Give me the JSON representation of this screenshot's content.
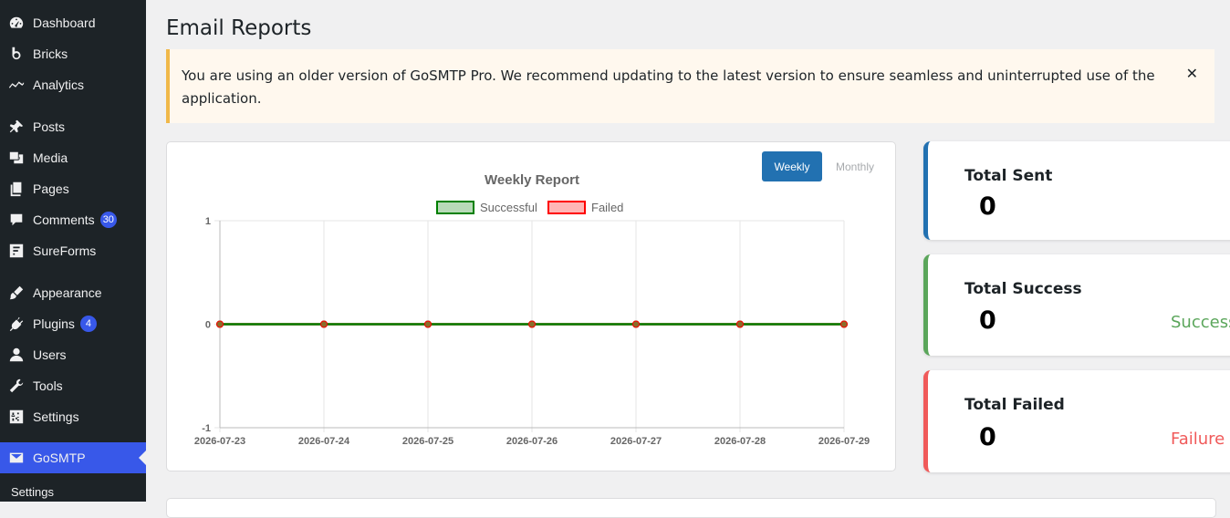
{
  "sidebar": {
    "items": [
      {
        "label": "Dashboard",
        "icon": "dashboard-icon"
      },
      {
        "label": "Bricks",
        "icon": "bricks-icon"
      },
      {
        "label": "Analytics",
        "icon": "analytics-icon"
      },
      {
        "label": "Posts",
        "icon": "pin-icon"
      },
      {
        "label": "Media",
        "icon": "media-icon"
      },
      {
        "label": "Pages",
        "icon": "pages-icon"
      },
      {
        "label": "Comments",
        "icon": "comment-icon",
        "badge": "30"
      },
      {
        "label": "SureForms",
        "icon": "sureforms-icon"
      },
      {
        "label": "Appearance",
        "icon": "brush-icon"
      },
      {
        "label": "Plugins",
        "icon": "plugin-icon",
        "badge": "4"
      },
      {
        "label": "Users",
        "icon": "user-icon"
      },
      {
        "label": "Tools",
        "icon": "wrench-icon"
      },
      {
        "label": "Settings",
        "icon": "settings-icon"
      },
      {
        "label": "GoSMTP",
        "icon": "envelope-icon",
        "active": true
      }
    ],
    "submenu": {
      "label": "Settings"
    }
  },
  "page": {
    "title": "Email Reports"
  },
  "notice": {
    "text": "You are using an older version of GoSMTP Pro. We recommend updating to the latest version to ensure seamless and uninterrupted use of the application.",
    "close": "✕"
  },
  "chart_controls": {
    "weekly": "Weekly",
    "monthly": "Monthly",
    "selected": "Weekly"
  },
  "chart_data": {
    "type": "line",
    "title": "Weekly Report",
    "categories": [
      "2026-07-23",
      "2026-07-24",
      "2026-07-25",
      "2026-07-26",
      "2026-07-27",
      "2026-07-28",
      "2026-07-29"
    ],
    "series": [
      {
        "name": "Successful",
        "values": [
          0,
          0,
          0,
          0,
          0,
          0,
          0
        ],
        "color": "#008000",
        "fill": "#b8dab8"
      },
      {
        "name": "Failed",
        "values": [
          0,
          0,
          0,
          0,
          0,
          0,
          0
        ],
        "color": "#ff0000",
        "fill": "#ffb6b6"
      }
    ],
    "ylim": [
      -1,
      1
    ],
    "yticks": [
      1,
      0,
      -1
    ],
    "grid": true,
    "legend": "top"
  },
  "stats": {
    "sent": {
      "title": "Total Sent",
      "value": "0",
      "color": "#2271b1"
    },
    "success": {
      "title": "Total Success",
      "value": "0",
      "status": "Success",
      "color": "#5ba65b"
    },
    "failed": {
      "title": "Total Failed",
      "value": "0",
      "status": "Failure",
      "color": "#f05a5a"
    }
  }
}
